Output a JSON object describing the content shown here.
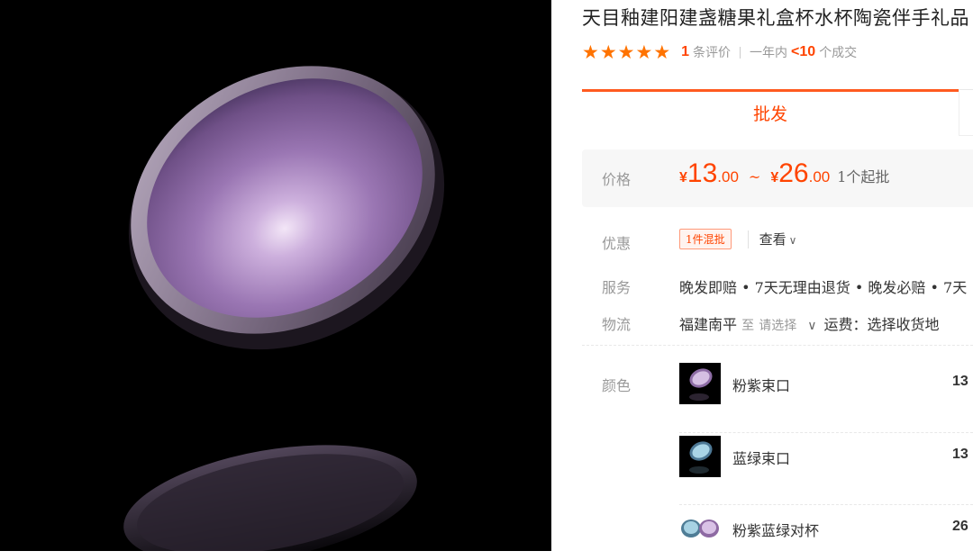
{
  "product": {
    "title": "天目釉建阳建盏糖果礼盒杯水杯陶瓷伴手礼品",
    "image_alt": "purple tenmoku cup"
  },
  "rating": {
    "stars": 5,
    "review_count": "1",
    "review_label": "条评价",
    "period_label": "一年内",
    "sold_count": "<10",
    "sold_label": "个成交"
  },
  "tabs": {
    "active": "批发"
  },
  "price": {
    "label": "价格",
    "currency": "¥",
    "low_int": "13",
    "low_dec": ".00",
    "tilde": "~",
    "high_int": "26",
    "high_dec": ".00",
    "min_order": "1个起批"
  },
  "promo": {
    "label": "优惠",
    "badge": "1件混批",
    "view": "查看"
  },
  "service": {
    "label": "服务",
    "text": "晚发即赔 • 7天无理由退货 • 晚发必赔 • 7天"
  },
  "logistics": {
    "label": "物流",
    "origin": "福建南平",
    "to": "至",
    "select": "请选择",
    "fee": "运费：选择收货地"
  },
  "color": {
    "label": "颜色",
    "options": [
      {
        "name": "粉紫束口",
        "price": "13"
      },
      {
        "name": "蓝绿束口",
        "price": "13"
      },
      {
        "name": "粉紫蓝绿对杯",
        "price": "26"
      }
    ]
  },
  "colors": {
    "accent": "#ff4400",
    "tab_border": "#ff5a1f",
    "star": "#ff7300"
  }
}
